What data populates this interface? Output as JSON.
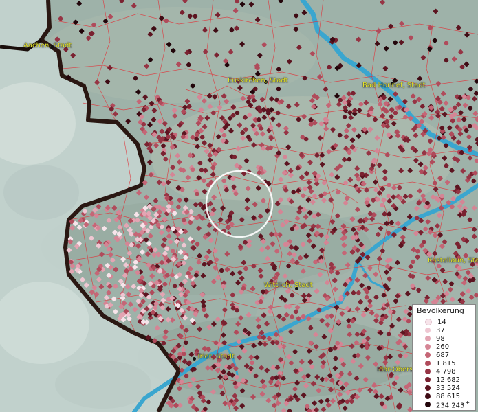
{
  "legend": {
    "title": "Bevölkerung",
    "entries": [
      {
        "label": "14",
        "color": "#f7e4ea"
      },
      {
        "label": "37",
        "color": "#efc7d2"
      },
      {
        "label": "98",
        "color": "#e3a5b3"
      },
      {
        "label": "260",
        "color": "#d58595"
      },
      {
        "label": "687",
        "color": "#c56676"
      },
      {
        "label": "1 815",
        "color": "#b04b5b"
      },
      {
        "label": "4 798",
        "color": "#963444"
      },
      {
        "label": "12 682",
        "color": "#7a2130"
      },
      {
        "label": "33 524",
        "color": "#5c1420"
      },
      {
        "label": "88 615",
        "color": "#3f0b14"
      },
      {
        "label": "234 243",
        "color": "#22050a",
        "plus": "+"
      }
    ]
  },
  "cities": [
    {
      "label": "Aachen, Stadt"
    },
    {
      "label": "Euskirchen, Stadt"
    },
    {
      "label": "Bad Honnef, Stadt"
    },
    {
      "label": "Kastellaun, Stadt"
    },
    {
      "label": "Wittlich, Stadt"
    },
    {
      "label": "Trier, Stadt"
    },
    {
      "label": "Idar-Oberstein"
    }
  ],
  "colors": {
    "border": "#2a1712",
    "admin_lines": "#e0343a",
    "river": "#3aa6cf",
    "terrain": "#9fb4ac",
    "label": "#e6e62a"
  }
}
